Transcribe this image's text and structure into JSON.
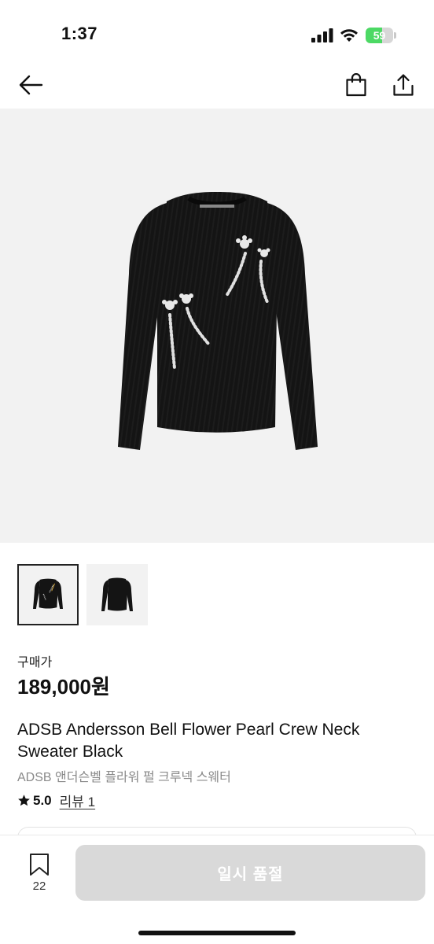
{
  "status_bar": {
    "time": "1:37",
    "battery_percent": "59",
    "battery_level": 0.59
  },
  "nav": {
    "back_icon": "arrow-left-icon",
    "bag_icon": "shopping-bag-icon",
    "share_icon": "share-icon"
  },
  "product": {
    "price_label": "구매가",
    "price": "189,000원",
    "title": "ADSB Andersson Bell Flower Pearl Crew Neck Sweater Black",
    "subtitle": "ADSB 앤더슨벨 플라워 펄 크루넥 스웨터",
    "rating": "5.0",
    "review_link": "리뷰 1"
  },
  "thumbnails": [
    {
      "name": "front-view",
      "active": true
    },
    {
      "name": "back-view",
      "active": false
    }
  ],
  "bottom_bar": {
    "wish_count": "22",
    "cta_label": "일시 품절"
  },
  "colors": {
    "accent_text": "#111111",
    "muted_text": "#8a8a8a",
    "cta_disabled": "#d9d9d9",
    "hero_bg": "#f2f2f2",
    "battery_green": "#4cd964"
  }
}
